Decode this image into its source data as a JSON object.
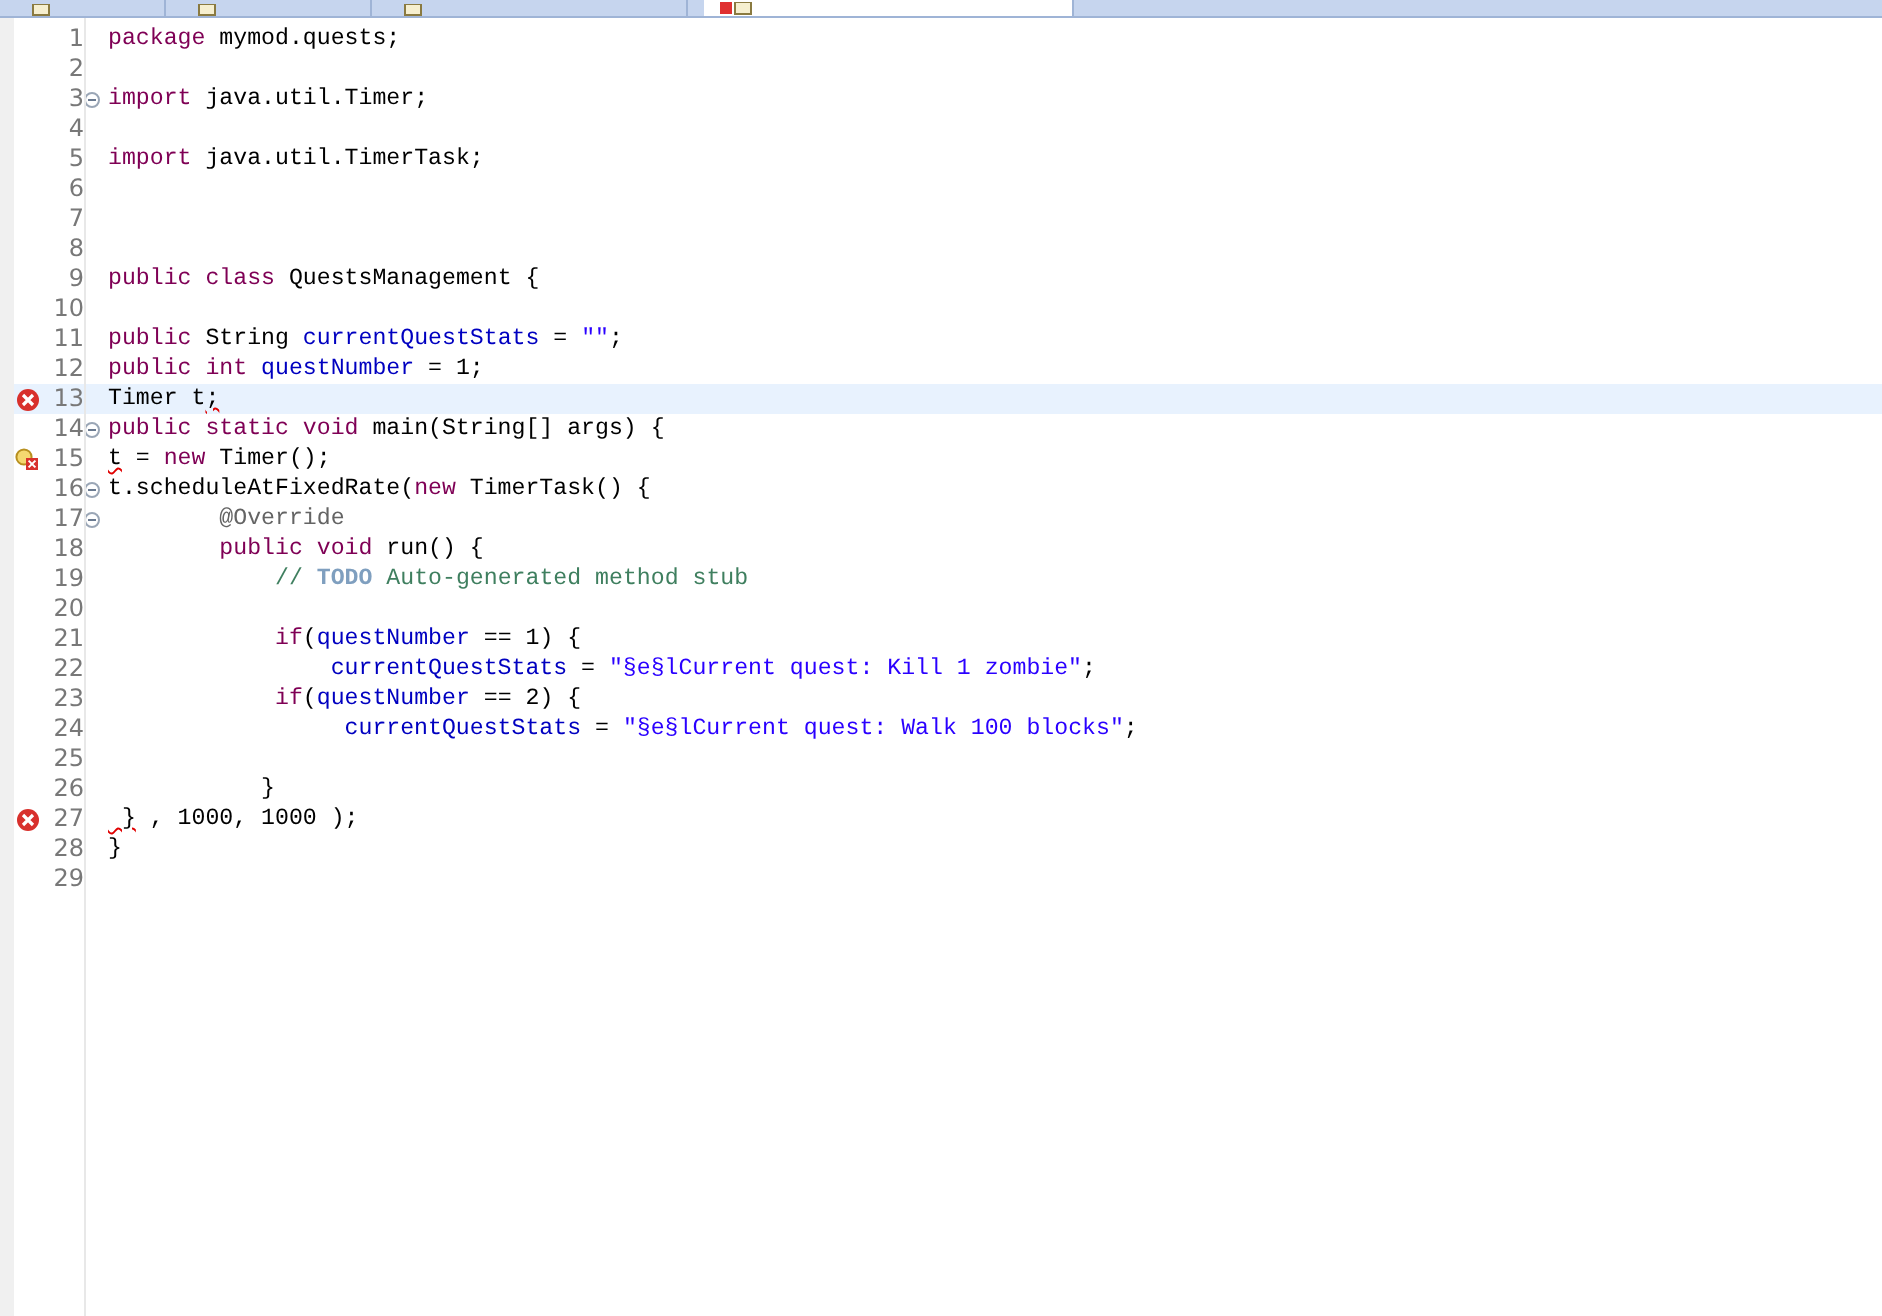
{
  "tabs": [
    {
      "selected": false,
      "has_error": false
    },
    {
      "selected": false,
      "has_error": false
    },
    {
      "selected": false,
      "has_error": false
    },
    {
      "selected": true,
      "has_error": true
    }
  ],
  "lines": [
    {
      "number": "1",
      "error": false,
      "quickfix": false,
      "fold": false,
      "current": false,
      "tokens": [
        {
          "kind": "keyword",
          "text": "package"
        },
        {
          "kind": "plain",
          "text": " mymod.quests;"
        }
      ]
    },
    {
      "number": "2",
      "error": false,
      "quickfix": false,
      "fold": false,
      "current": false
    },
    {
      "number": "3",
      "error": false,
      "quickfix": false,
      "fold": true,
      "current": false,
      "tokens": [
        {
          "kind": "keyword",
          "text": "import"
        },
        {
          "kind": "plain",
          "text": " java.util.Timer;"
        }
      ]
    },
    {
      "number": "4",
      "error": false,
      "quickfix": false,
      "fold": false,
      "current": false
    },
    {
      "number": "5",
      "error": false,
      "quickfix": false,
      "fold": false,
      "current": false,
      "tokens": [
        {
          "kind": "keyword",
          "text": "import"
        },
        {
          "kind": "plain",
          "text": " java.util.TimerTask;"
        }
      ]
    },
    {
      "number": "6",
      "error": false,
      "quickfix": false,
      "fold": false,
      "current": false
    },
    {
      "number": "7",
      "error": false,
      "quickfix": false,
      "fold": false,
      "current": false
    },
    {
      "number": "8",
      "error": false,
      "quickfix": false,
      "fold": false,
      "current": false
    },
    {
      "number": "9",
      "error": false,
      "quickfix": false,
      "fold": false,
      "current": false,
      "tokens": [
        {
          "kind": "keyword",
          "text": "public class"
        },
        {
          "kind": "plain",
          "text": " QuestsManagement {"
        }
      ]
    },
    {
      "number": "10",
      "error": false,
      "quickfix": false,
      "fold": false,
      "current": false
    },
    {
      "number": "11",
      "error": false,
      "quickfix": false,
      "fold": false,
      "current": false,
      "tokens": [
        {
          "kind": "keyword",
          "text": "public"
        },
        {
          "kind": "plain",
          "text": " String "
        },
        {
          "kind": "field",
          "text": "currentQuestStats"
        },
        {
          "kind": "plain",
          "text": " = "
        },
        {
          "kind": "string",
          "text": "\"\""
        },
        {
          "kind": "plain",
          "text": ";"
        }
      ]
    },
    {
      "number": "12",
      "error": false,
      "quickfix": false,
      "fold": false,
      "current": false,
      "tokens": [
        {
          "kind": "keyword",
          "text": "public int"
        },
        {
          "kind": "field",
          "text": " questNumber"
        },
        {
          "kind": "plain",
          "text": " = 1;"
        }
      ]
    },
    {
      "number": "13",
      "error": true,
      "quickfix": false,
      "fold": false,
      "current": true,
      "tokens": [
        {
          "kind": "plain",
          "text": "Timer t",
          "squiggle": false
        },
        {
          "kind": "plain",
          "text": ";",
          "squiggle": true
        }
      ]
    },
    {
      "number": "14",
      "error": false,
      "quickfix": false,
      "fold": true,
      "current": false,
      "tokens": [
        {
          "kind": "keyword",
          "text": "public static void"
        },
        {
          "kind": "plain",
          "text": " main(String[] args) {"
        }
      ]
    },
    {
      "number": "15",
      "error": true,
      "quickfix": true,
      "fold": false,
      "current": false,
      "tokens": [
        {
          "kind": "plain",
          "text": "t",
          "squiggle": true
        },
        {
          "kind": "plain",
          "text": " = ",
          "squiggle": false
        },
        {
          "kind": "keyword",
          "text": "new"
        },
        {
          "kind": "plain",
          "text": " Timer();",
          "squiggle": false
        }
      ]
    },
    {
      "number": "16",
      "error": false,
      "quickfix": false,
      "fold": true,
      "current": false,
      "tokens": [
        {
          "kind": "plain",
          "text": "t.scheduleAtFixedRate("
        },
        {
          "kind": "keyword",
          "text": "new"
        },
        {
          "kind": "plain",
          "text": " TimerTask() {"
        }
      ]
    },
    {
      "number": "17",
      "error": false,
      "quickfix": false,
      "fold": true,
      "current": false,
      "tokens": [
        {
          "kind": "annotation",
          "text": "        @Override"
        }
      ]
    },
    {
      "number": "18",
      "error": false,
      "quickfix": false,
      "fold": false,
      "current": false,
      "tokens": [
        {
          "kind": "keyword",
          "text": "        public void"
        },
        {
          "kind": "plain",
          "text": " run() {"
        }
      ]
    },
    {
      "number": "19",
      "error": false,
      "quickfix": false,
      "fold": false,
      "current": false,
      "tokens": [
        {
          "kind": "comment",
          "text": "            // "
        },
        {
          "kind": "task",
          "text": "TODO"
        },
        {
          "kind": "comment",
          "text": " Auto-generated method stub"
        }
      ]
    },
    {
      "number": "20",
      "error": false,
      "quickfix": false,
      "fold": false,
      "current": false
    },
    {
      "number": "21",
      "error": false,
      "quickfix": false,
      "fold": false,
      "current": false,
      "tokens": [
        {
          "kind": "keyword",
          "text": "            if"
        },
        {
          "kind": "plain",
          "text": "("
        },
        {
          "kind": "field",
          "text": "questNumber"
        },
        {
          "kind": "plain",
          "text": " == 1) {"
        }
      ]
    },
    {
      "number": "22",
      "error": false,
      "quickfix": false,
      "fold": false,
      "current": false,
      "tokens": [
        {
          "kind": "field",
          "text": "                currentQuestStats"
        },
        {
          "kind": "plain",
          "text": " = "
        },
        {
          "kind": "string",
          "text": "\"§e§lCurrent quest: Kill 1 zombie\""
        },
        {
          "kind": "plain",
          "text": ";"
        }
      ]
    },
    {
      "number": "23",
      "error": false,
      "quickfix": false,
      "fold": false,
      "current": false,
      "tokens": [
        {
          "kind": "keyword",
          "text": "            if"
        },
        {
          "kind": "plain",
          "text": "("
        },
        {
          "kind": "field",
          "text": "questNumber"
        },
        {
          "kind": "plain",
          "text": " == 2) {"
        }
      ]
    },
    {
      "number": "24",
      "error": false,
      "quickfix": false,
      "fold": false,
      "current": false,
      "tokens": [
        {
          "kind": "field",
          "text": "                 currentQuestStats"
        },
        {
          "kind": "plain",
          "text": " = "
        },
        {
          "kind": "string",
          "text": "\"§e§lCurrent quest: Walk 100 blocks\""
        },
        {
          "kind": "plain",
          "text": ";"
        }
      ]
    },
    {
      "number": "25",
      "error": false,
      "quickfix": false,
      "fold": false,
      "current": false
    },
    {
      "number": "26",
      "error": false,
      "quickfix": false,
      "fold": false,
      "current": false,
      "tokens": [
        {
          "kind": "plain",
          "text": "           }"
        }
      ]
    },
    {
      "number": "27",
      "error": true,
      "quickfix": false,
      "fold": false,
      "current": false,
      "tokens": [
        {
          "kind": "plain",
          "text": " }",
          "squiggle": true
        },
        {
          "kind": "plain",
          "text": " , 1000, 1000 );",
          "squiggle": false
        }
      ]
    },
    {
      "number": "28",
      "error": false,
      "quickfix": false,
      "fold": false,
      "current": false,
      "tokens": [
        {
          "kind": "plain",
          "text": "}"
        }
      ]
    },
    {
      "number": "29",
      "error": false,
      "quickfix": false,
      "fold": false,
      "current": false
    }
  ]
}
